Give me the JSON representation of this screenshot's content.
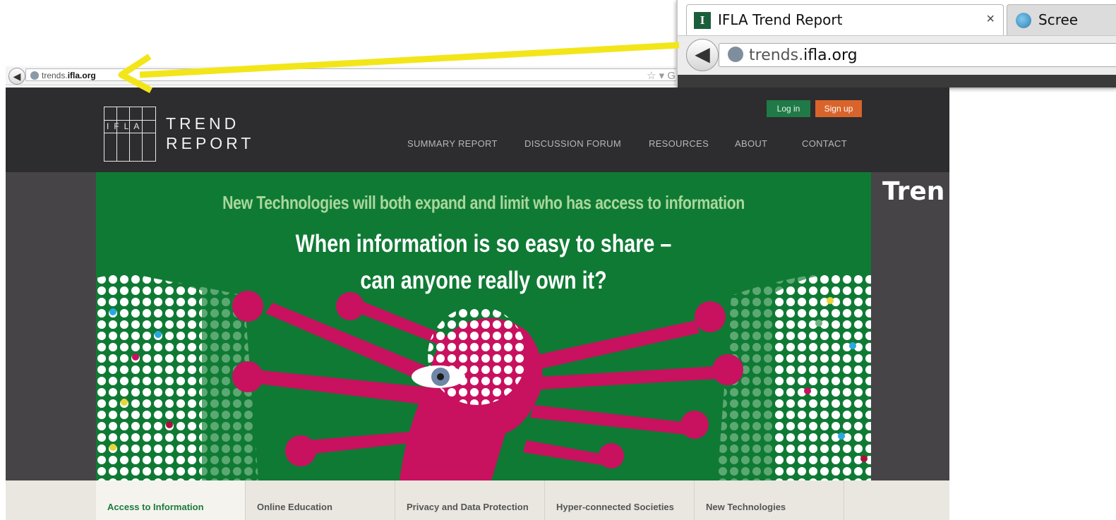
{
  "mini_browser": {
    "back_icon": "back-arrow-icon",
    "url_prefix": "trends.",
    "url_domain": "ifla.org",
    "star_icon": "☆ ▾ G"
  },
  "zoom_browser": {
    "tab_title": "IFLA Trend Report",
    "tab_close": "×",
    "favicon_letter": "I",
    "second_tab_title": "Scree",
    "url_prefix": "trends.",
    "url_domain": "ifla.org"
  },
  "site": {
    "logo_ifla": "IFLA",
    "logo_line1": "TREND",
    "logo_line2": "REPORT",
    "login_label": "Log in",
    "signup_label": "Sign up",
    "nav": [
      "SUMMARY REPORT",
      "DISCUSSION FORUM",
      "RESOURCES",
      "ABOUT",
      "CONTACT"
    ],
    "hero_subtitle": "New Technologies will both expand and limit who has access to information",
    "hero_heading_1": "When information is so easy to share –",
    "hero_heading_2": "can anyone really own it?",
    "side_text": "Tren",
    "tabs": [
      "Access to Information",
      "Online Education",
      "Privacy and Data Protection",
      "Hyper-connected Societies",
      "New Technologies"
    ]
  },
  "colors": {
    "header_bg": "#2d2c2e",
    "hero_green": "#0f7a34",
    "figure_magenta": "#c8115f",
    "login_green": "#1f7a47",
    "signup_orange": "#d9642b",
    "arrow_yellow": "#f2e61a"
  }
}
